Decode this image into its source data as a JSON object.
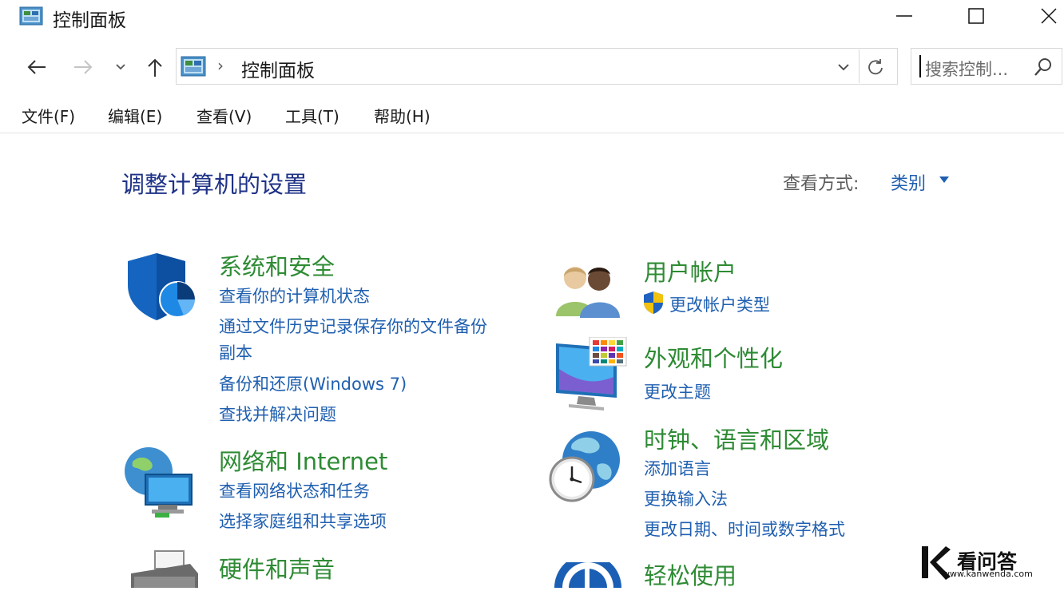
{
  "window": {
    "title": "控制面板"
  },
  "nav": {
    "breadcrumb": "控制面板",
    "search_placeholder": "搜索控制..."
  },
  "menu": [
    "文件(F)",
    "编辑(E)",
    "查看(V)",
    "工具(T)",
    "帮助(H)"
  ],
  "main": {
    "title": "调整计算机的设置",
    "view_label": "查看方式:",
    "view_value": "类别"
  },
  "categories": {
    "system": {
      "title": "系统和安全",
      "links": [
        "查看你的计算机状态",
        "通过文件历史记录保存你的文件备份",
        "副本",
        "备份和还原(Windows 7)",
        "查找并解决问题"
      ]
    },
    "network": {
      "title": "网络和 Internet",
      "links": [
        "查看网络状态和任务",
        "选择家庭组和共享选项"
      ]
    },
    "hardware": {
      "title": "硬件和声音"
    },
    "users": {
      "title": "用户帐户",
      "links": [
        "更改帐户类型"
      ]
    },
    "appearance": {
      "title": "外观和个性化",
      "links": [
        "更改主题"
      ]
    },
    "clock": {
      "title": "时钟、语言和区域",
      "links": [
        "添加语言",
        "更换输入法",
        "更改日期、时间或数字格式"
      ]
    },
    "ease": {
      "title": "轻松使用"
    }
  },
  "watermark": {
    "name": "看问答",
    "url": "www.kanwenda.com"
  },
  "colors": {
    "category_title": "#2e8b34",
    "link": "#1f5fb0",
    "page_title": "#1e3287"
  }
}
